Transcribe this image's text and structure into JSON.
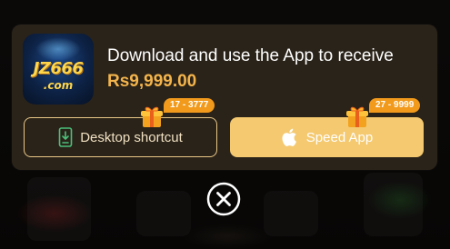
{
  "promo": {
    "app_brand": "JZ666",
    "app_domain": ".com",
    "title": "Download and use the App to receive",
    "amount": "Rs9,999.00",
    "desktop_button": {
      "label": "Desktop shortcut",
      "icon": "phone-download-icon",
      "badge": "17 - 3777",
      "gift_icon": "gift-icon"
    },
    "speed_button": {
      "label": "Speed App",
      "icon": "apple-icon",
      "badge": "27 - 9999",
      "gift_icon": "gift-icon"
    }
  },
  "close": {
    "icon": "close-circle-icon"
  },
  "colors": {
    "card_bg": "#2a2319",
    "accent_gold": "#f3b44c",
    "speed_button_bg": "#f4c970",
    "badge_bg": "#f29a1b",
    "desktop_border": "#e9c787"
  }
}
